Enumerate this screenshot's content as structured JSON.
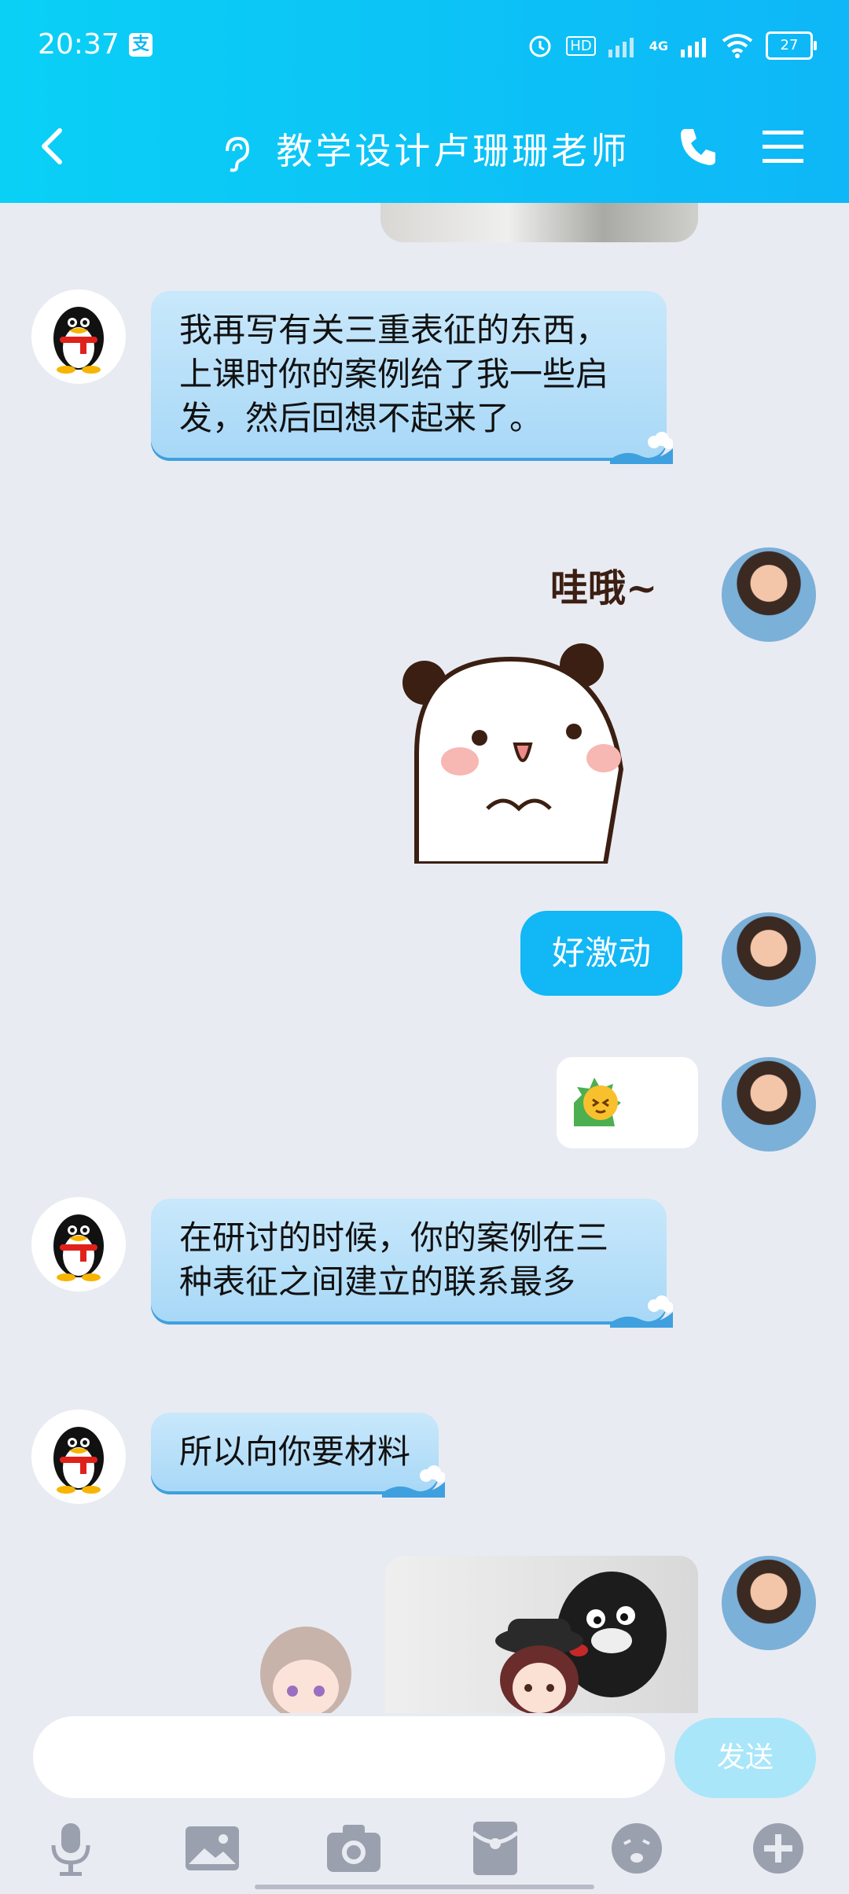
{
  "status_bar": {
    "time": "20:37",
    "pay_icon": "支",
    "network": "4G",
    "hd": "HD",
    "battery": "27"
  },
  "header": {
    "title": "教学设计卢珊珊老师",
    "back_icon": "back-arrow-icon",
    "ear_icon": "ear-icon",
    "call_icon": "phone-icon",
    "menu_icon": "menu-icon"
  },
  "messages": [
    {
      "side": "in",
      "text": "我再写有关三重表征的东西，上课时你的案例给了我一些启发，然后回想不起来了。"
    },
    {
      "side": "out",
      "type": "sticker",
      "text": "哇哦~"
    },
    {
      "side": "out",
      "text": "好激动"
    },
    {
      "side": "out",
      "type": "emoji"
    },
    {
      "side": "in",
      "text": "在研讨的时候，你的案例在三种表征之间建立的联系最多"
    },
    {
      "side": "in",
      "text": "所以向你要材料"
    },
    {
      "side": "out",
      "type": "image"
    }
  ],
  "composer": {
    "send_label": "发送"
  },
  "toolbar": [
    "mic-icon",
    "image-icon",
    "camera-icon",
    "red-packet-icon",
    "emoji-icon",
    "plus-icon"
  ],
  "colors": {
    "header": "#0eb7f7",
    "bubble_out": "#12b7f5",
    "bubble_in": "#bde2fa",
    "background": "#e9ebf2"
  }
}
